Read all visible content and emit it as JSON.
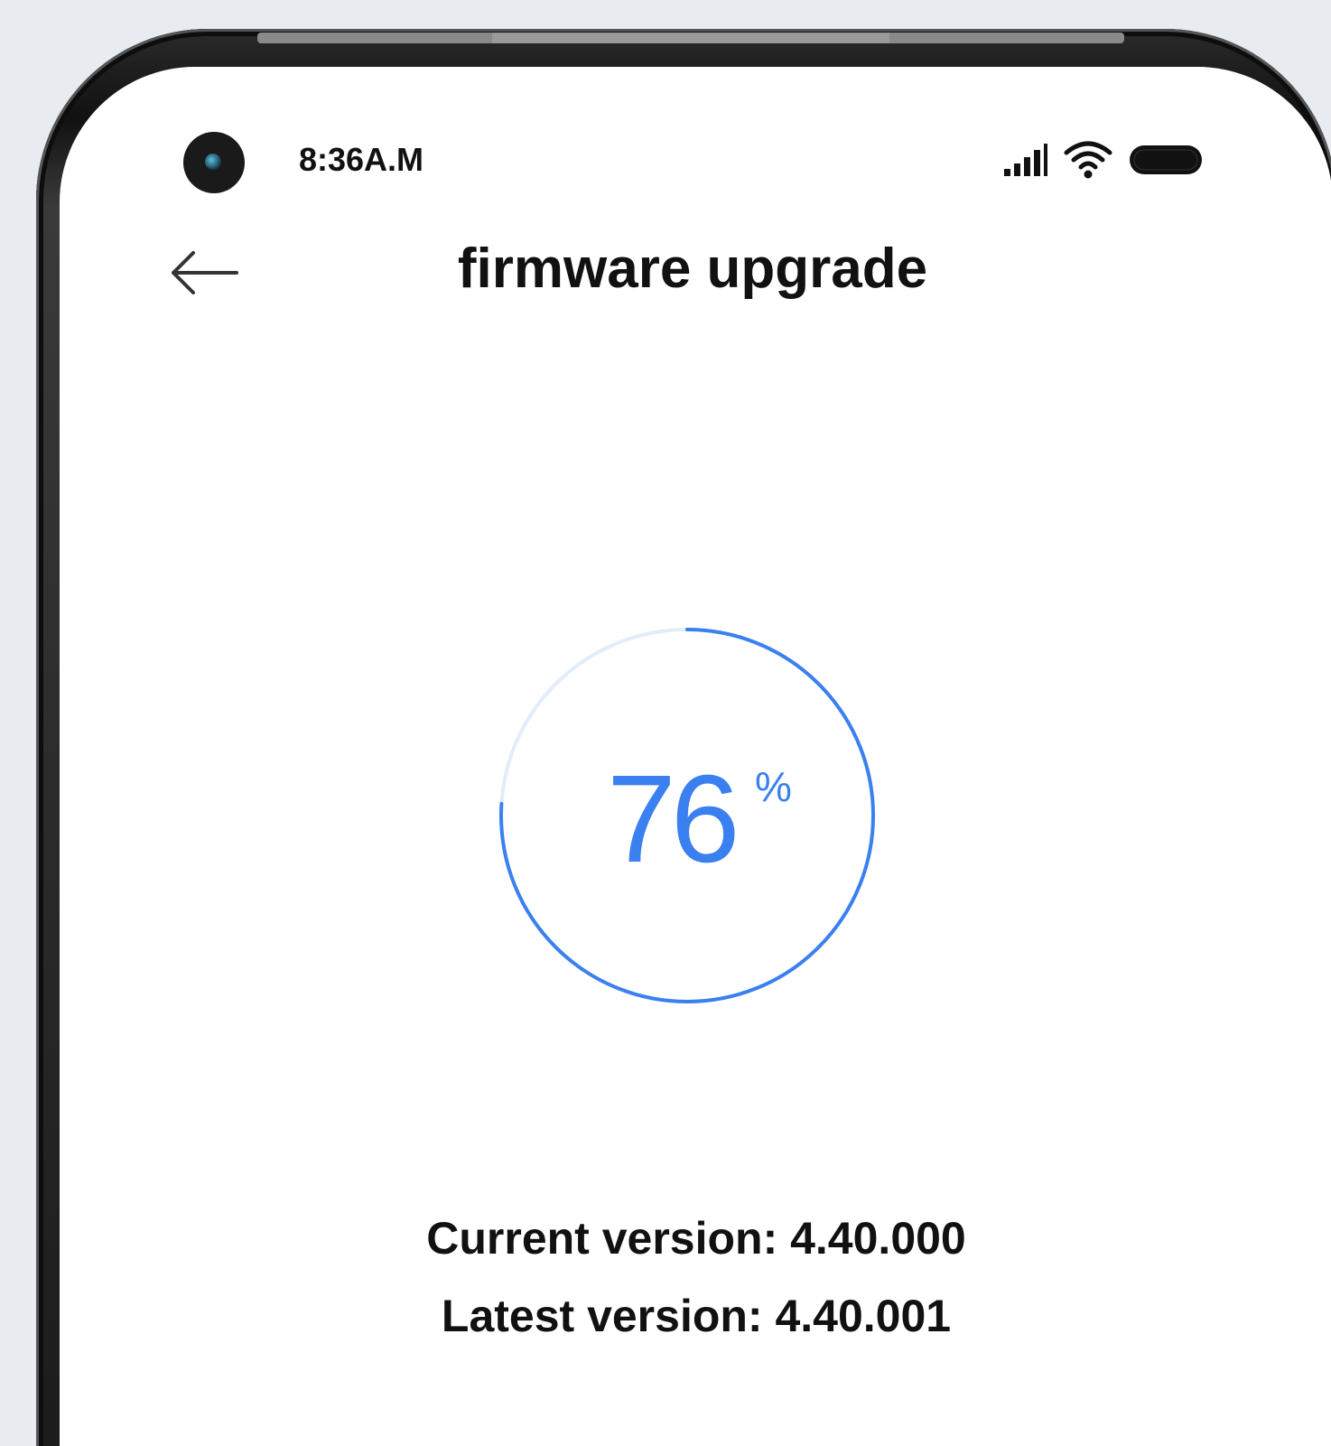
{
  "status_bar": {
    "time": "8:36A.M",
    "icons": [
      "signal-icon",
      "wifi-icon",
      "battery-icon"
    ]
  },
  "header": {
    "back_icon": "arrow-left-icon",
    "title": "firmware upgrade"
  },
  "progress": {
    "value": "76",
    "unit": "%",
    "fraction": 0.76,
    "color": "#3b80f0"
  },
  "versions": {
    "current": "Current version: 4.40.000",
    "latest": "Latest version: 4.40.001"
  }
}
